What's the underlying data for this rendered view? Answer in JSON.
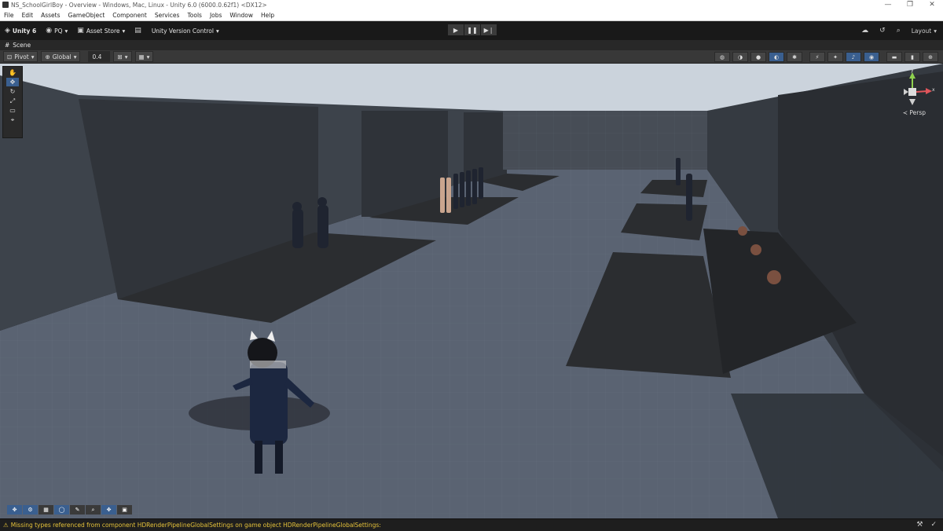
{
  "window": {
    "title": "NS_SchoolGirlBoy - Overview - Windows, Mac, Linux - Unity 6.0 (6000.0.62f1) <DX12>",
    "controls": [
      "—",
      "❐",
      "✕"
    ]
  },
  "menu": [
    "File",
    "Edit",
    "Assets",
    "GameObject",
    "Component",
    "Services",
    "Tools",
    "Jobs",
    "Window",
    "Help"
  ],
  "toolbar": {
    "unity_label": "Unity 6",
    "account_label": "PQ",
    "asset_store_label": "Asset Store",
    "version_control_label": "Unity Version Control",
    "layout_label": "Layout"
  },
  "scene_tab": {
    "label": "Scene"
  },
  "overlay": {
    "pivot_label": "Pivot",
    "global_label": "Global",
    "snap_value": "0.4"
  },
  "scene_view": {
    "camera_mode": "Persp",
    "gizmo_axes": {
      "x": "x",
      "y": "y"
    },
    "colors": {
      "sky": "#c9d2dc",
      "floor": "#596270",
      "wall": "#3b4047",
      "platform": "#2b2d30",
      "accent": "#3a5f8f"
    }
  },
  "status": {
    "message": "Missing types referenced from component HDRenderPipelineGlobalSettings on game object HDRenderPipelineGlobalSettings:"
  }
}
